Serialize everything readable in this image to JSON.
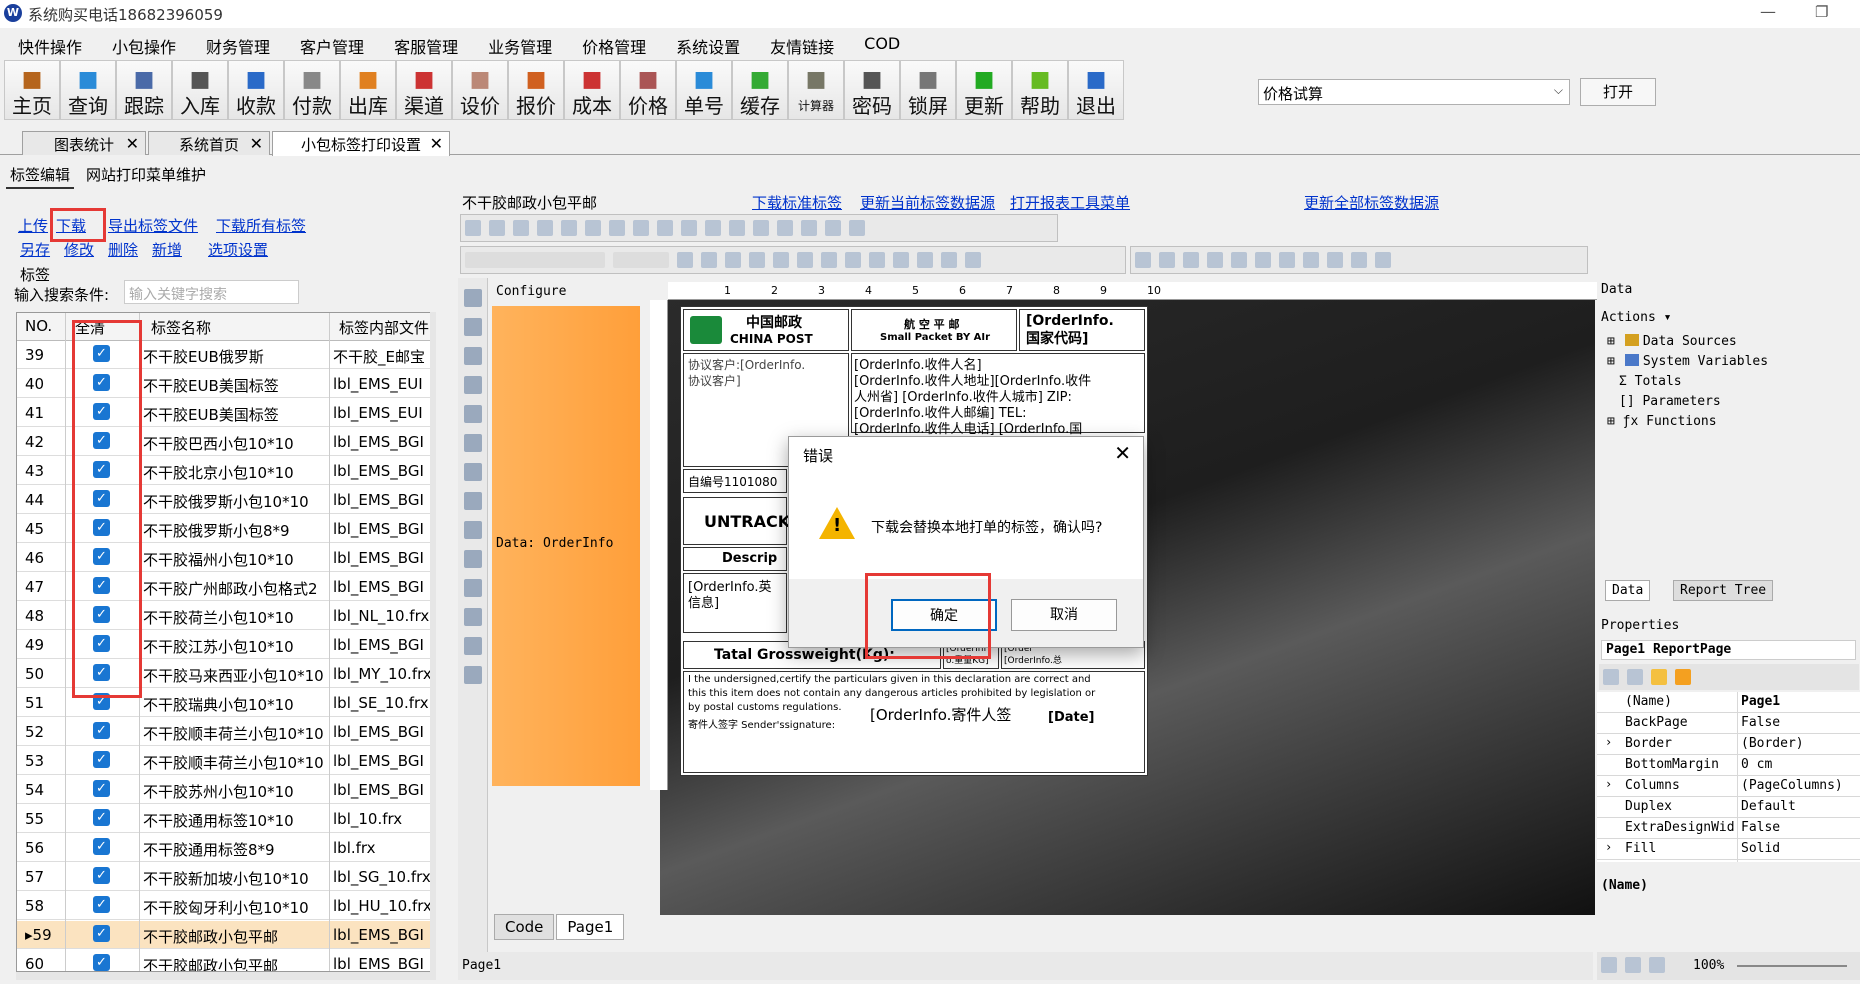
{
  "window": {
    "title": "系统购买电话18682396059"
  },
  "menu": [
    "快件操作",
    "小包操作",
    "财务管理",
    "客户管理",
    "客服管理",
    "业务管理",
    "价格管理",
    "系统设置",
    "友情链接",
    "COD"
  ],
  "toolbar": [
    {
      "label": "主页",
      "icon": "home-icon",
      "color": "#b5651d"
    },
    {
      "label": "查询",
      "icon": "search-icon",
      "color": "#2a8bd8"
    },
    {
      "label": "跟踪",
      "icon": "wifi-icon",
      "color": "#4a6aa8"
    },
    {
      "label": "入库",
      "icon": "hammer-icon",
      "color": "#555"
    },
    {
      "label": "收款",
      "icon": "yen-icon",
      "color": "#2a6ac8"
    },
    {
      "label": "付款",
      "icon": "pay-icon",
      "color": "#888"
    },
    {
      "label": "出库",
      "icon": "outbox-icon",
      "color": "#e08020"
    },
    {
      "label": "渠道",
      "icon": "channel-icon",
      "color": "#c33"
    },
    {
      "label": "设价",
      "icon": "set-price-icon",
      "color": "#b87"
    },
    {
      "label": "报价",
      "icon": "quote-icon",
      "color": "#d06020"
    },
    {
      "label": "成本",
      "icon": "bar-chart-icon",
      "color": "#c33"
    },
    {
      "label": "价格",
      "icon": "price-icon",
      "color": "#a55"
    },
    {
      "label": "单号",
      "icon": "eye-icon",
      "color": "#2a8bd8"
    },
    {
      "label": "缓存",
      "icon": "refresh-icon",
      "color": "#3a3"
    },
    {
      "label": "计算器",
      "icon": "calculator-icon",
      "color": "#776"
    },
    {
      "label": "密码",
      "icon": "key-icon",
      "color": "#555"
    },
    {
      "label": "锁屏",
      "icon": "lock-icon",
      "color": "#777"
    },
    {
      "label": "更新",
      "icon": "download-arrow-icon",
      "color": "#2a2"
    },
    {
      "label": "帮助",
      "icon": "help-icon",
      "color": "#6b2"
    },
    {
      "label": "退出",
      "icon": "power-icon",
      "color": "#2a6ac8"
    }
  ],
  "price_calc": {
    "value": "价格试算",
    "open_label": "打开"
  },
  "doc_tabs": [
    "图表统计",
    "系统首页",
    "小包标签打印设置"
  ],
  "sub_tabs": [
    "标签编辑",
    "网站打印菜单维护"
  ],
  "actions": {
    "upload": "上传",
    "download": "下载",
    "export": "导出标签文件",
    "download_all": "下载所有标签",
    "save_as": "另存",
    "edit": "修改",
    "delete": "删除",
    "add": "新增",
    "options": "选项设置"
  },
  "labels_section": {
    "title": "标签",
    "search_label": "输入搜索条件:",
    "search_placeholder": "输入关键字搜索"
  },
  "grid": {
    "headers": [
      "NO.",
      "全清",
      "标签名称",
      "标签内部文件"
    ],
    "rows": [
      {
        "no": "39",
        "name": "不干胶EUB俄罗斯",
        "file": "不干胶_E邮宝"
      },
      {
        "no": "40",
        "name": "不干胶EUB美国标签",
        "file": "lbl_EMS_EUI"
      },
      {
        "no": "41",
        "name": "不干胶EUB美国标签",
        "file": "lbl_EMS_EUI"
      },
      {
        "no": "42",
        "name": "不干胶巴西小包10*10",
        "file": "lbl_EMS_BGI"
      },
      {
        "no": "43",
        "name": "不干胶北京小包10*10",
        "file": "lbl_EMS_BGI"
      },
      {
        "no": "44",
        "name": "不干胶俄罗斯小包10*10",
        "file": "lbl_EMS_BGI"
      },
      {
        "no": "45",
        "name": "不干胶俄罗斯小包8*9",
        "file": "lbl_EMS_BGI"
      },
      {
        "no": "46",
        "name": "不干胶福州小包10*10",
        "file": "lbl_EMS_BGI"
      },
      {
        "no": "47",
        "name": "不干胶广州邮政小包格式2",
        "file": "lbl_EMS_BGI"
      },
      {
        "no": "48",
        "name": "不干胶荷兰小包10*10",
        "file": "lbl_NL_10.frx"
      },
      {
        "no": "49",
        "name": "不干胶江苏小包10*10",
        "file": "lbl_EMS_BGI"
      },
      {
        "no": "50",
        "name": "不干胶马来西亚小包10*10",
        "file": "lbl_MY_10.frx"
      },
      {
        "no": "51",
        "name": "不干胶瑞典小包10*10",
        "file": "lbl_SE_10.frx"
      },
      {
        "no": "52",
        "name": "不干胶顺丰荷兰小包10*10",
        "file": "lbl_EMS_BGI"
      },
      {
        "no": "53",
        "name": "不干胶顺丰荷兰小包10*10",
        "file": "lbl_EMS_BGI"
      },
      {
        "no": "54",
        "name": "不干胶苏州小包10*10",
        "file": "lbl_EMS_BGI"
      },
      {
        "no": "55",
        "name": "不干胶通用标签10*10",
        "file": "lbl_10.frx"
      },
      {
        "no": "56",
        "name": "不干胶通用标签8*9",
        "file": "lbl.frx"
      },
      {
        "no": "57",
        "name": "不干胶新加坡小包10*10",
        "file": "lbl_SG_10.frx"
      },
      {
        "no": "58",
        "name": "不干胶匈牙利小包10*10",
        "file": "lbl_HU_10.frx"
      },
      {
        "no": "59",
        "name": "不干胶邮政小包平邮",
        "file": "lbl_EMS_BGI",
        "selected": true,
        "marker": "▸"
      },
      {
        "no": "60",
        "name": "不干胶邮政小包平邮",
        "file": "lbl_EMS_BGI"
      }
    ]
  },
  "designer": {
    "report_title": "不干胶邮政小包平邮",
    "links": [
      "下载标准标签",
      "更新当前标签数据源",
      "打开报表工具菜单",
      "更新全部标签数据源"
    ],
    "configure": "Configure",
    "data_band": "Data: OrderInfo",
    "ruler": [
      "1",
      "2",
      "3",
      "4",
      "5",
      "6",
      "7",
      "8",
      "9",
      "10"
    ],
    "page": {
      "cn_post": "中国邮政",
      "china_post": "CHINA POST",
      "air_cn": "航 空 平 邮",
      "air_en": "Small Packet BY AIr",
      "country": "[OrderInfo.\n国家代码]",
      "customer": "协议客户:[OrderInfo.",
      "customer2": "协议客户]",
      "recv1": "[OrderInfo.收件人名]",
      "recv2": "[OrderInfo.收件人地址][OrderInfo.收件",
      "recv3": "人州省] [OrderInfo.收件人城市] ZIP:",
      "recv4": "[OrderInfo.收件人邮编] TEL:",
      "recv5": "[OrderInfo.收件人电话] [OrderInfo.国",
      "serial": "自编号1101080",
      "untracked": "UNTRACKE",
      "descrip": "Descrip",
      "info1": "[OrderInfo.英",
      "info2": "信息]",
      "gross": "Tatal Grossweight(Kg):",
      "gw1": "[OrderInf\no.重量KG]",
      "gw2": "[Order\n[OrderInfo.总",
      "decl1": "I the undersigned,certify the particulars given in this declaration are correct and",
      "decl2": "this this item does not contain any dangerous articles prohibited by legislation or",
      "decl3": "by postal customs regulations.",
      "sender_label": "寄件人签字 Sender'ssignature:",
      "sender_val": "[OrderInfo.寄件人签",
      "date": "[Date]"
    },
    "bottom_tabs": [
      "Code",
      "Page1"
    ],
    "status": "Page1"
  },
  "dialog": {
    "title": "错误",
    "message": "下载会替换本地打单的标签，确认吗?",
    "ok": "确定",
    "cancel": "取消"
  },
  "right_panel": {
    "data_title": "Data",
    "actions": "Actions",
    "tree": [
      "Data Sources",
      "System Variables",
      "Totals",
      "Parameters",
      "Functions"
    ],
    "tabs": [
      "Data",
      "Report Tree"
    ],
    "props_title": "Properties",
    "object": "Page1 ReportPage",
    "props": [
      {
        "name": "(Name)",
        "value": "Page1"
      },
      {
        "name": "BackPage",
        "value": "False"
      },
      {
        "name": "Border",
        "value": "(Border)",
        "expand": true
      },
      {
        "name": "BottomMargin",
        "value": "0 cm"
      },
      {
        "name": "Columns",
        "value": "(PageColumns)",
        "expand": true
      },
      {
        "name": "Duplex",
        "value": "Default"
      },
      {
        "name": "ExtraDesignWid",
        "value": "False"
      },
      {
        "name": "Fill",
        "value": "Solid",
        "expand": true
      }
    ],
    "desc": "(Name)",
    "zoom": "100%"
  }
}
